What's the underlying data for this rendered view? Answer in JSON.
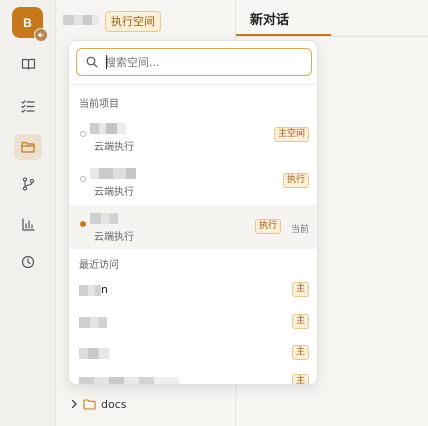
{
  "rail": {
    "avatar_letter": "B"
  },
  "sidebar": {
    "space_tag": "执行空间",
    "tree": {
      "folder_name": "docs"
    }
  },
  "main": {
    "tab_label": "新对话"
  },
  "switcher": {
    "search_placeholder": "搜索空间...",
    "current_section_title": "当前项目",
    "current_items": [
      {
        "sub": "云端执行",
        "badge": "主空间",
        "selected": false
      },
      {
        "sub": "云端执行",
        "badge": "执行",
        "selected": false
      },
      {
        "sub": "云端执行",
        "badge": "执行",
        "status": "当前",
        "selected": true
      }
    ],
    "recent_section_title": "最近访问",
    "recent_items": [
      {
        "name": "n",
        "badge": "主"
      },
      {
        "name": "",
        "badge": "主"
      },
      {
        "name": "",
        "badge": "主"
      },
      {
        "name": "",
        "badge": "主"
      }
    ]
  },
  "colors": {
    "accent": "#c6781d",
    "badge_bg": "#fbefd7",
    "badge_border": "#e8c98c",
    "badge_text": "#9b5f12"
  }
}
